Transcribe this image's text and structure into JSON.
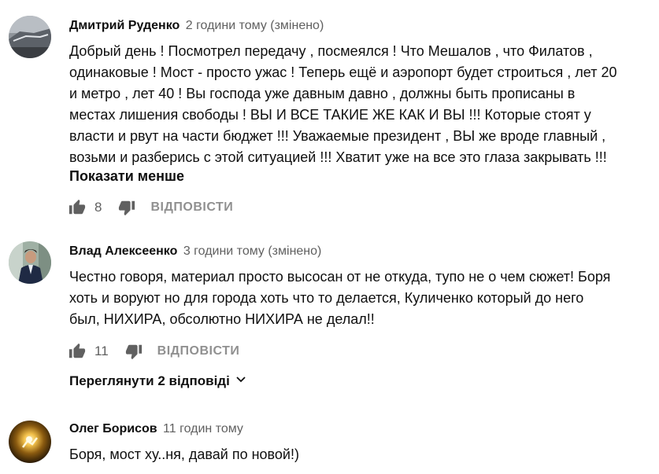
{
  "comments": [
    {
      "author": "Дмитрий Руденко",
      "meta": "2 години тому (змінено)",
      "lines": [
        "Добрый день ! Посмотрел передачу , посмеялся ! Что Мешалов , что Филатов ,",
        "одинаковые ! Мост - просто ужас ! Теперь ещё и аэропорт будет строиться , лет 20",
        "и метро , лет 40 ! Вы господа уже давным давно , должны быть прописаны в",
        "местах лишения свободы ! ВЫ И ВСЕ ТАКИЕ ЖЕ КАК И ВЫ !!! Которые стоят у",
        "власти и рвут на части бюджет !!! Уважаемые президент , ВЫ же вроде главный ,",
        "возьми и разберись с этой ситуацией !!! Хватит уже на все это глаза закрывать !!!"
      ],
      "show_less": "Показати менше",
      "likes": "8",
      "reply_label": "ВІДПОВІСТИ"
    },
    {
      "author": "Влад Алексеенко",
      "meta": "3 години тому (змінено)",
      "lines": [
        "Честно говоря, материал просто высосан от не откуда, тупо не о чем сюжет! Боря",
        "хоть и воруют но для города хоть что то делается, Куличенко который до него",
        "был, НИХИРА, обсолютно НИХИРА не делал!!"
      ],
      "likes": "11",
      "reply_label": "ВІДПОВІСТИ",
      "view_replies": "Переглянути 2 відповіді"
    },
    {
      "author": "Олег Борисов",
      "meta": "11 годин тому",
      "lines": [
        "Боря, мост ху..ня, давай по новой!)"
      ]
    }
  ],
  "icons": {
    "like": "thumb-up-icon",
    "dislike": "thumb-down-icon",
    "expand": "chevron-down-icon"
  },
  "colors": {
    "text": "#0f0f0f",
    "meta": "#606060",
    "reply": "#909090",
    "icon": "#606060"
  }
}
